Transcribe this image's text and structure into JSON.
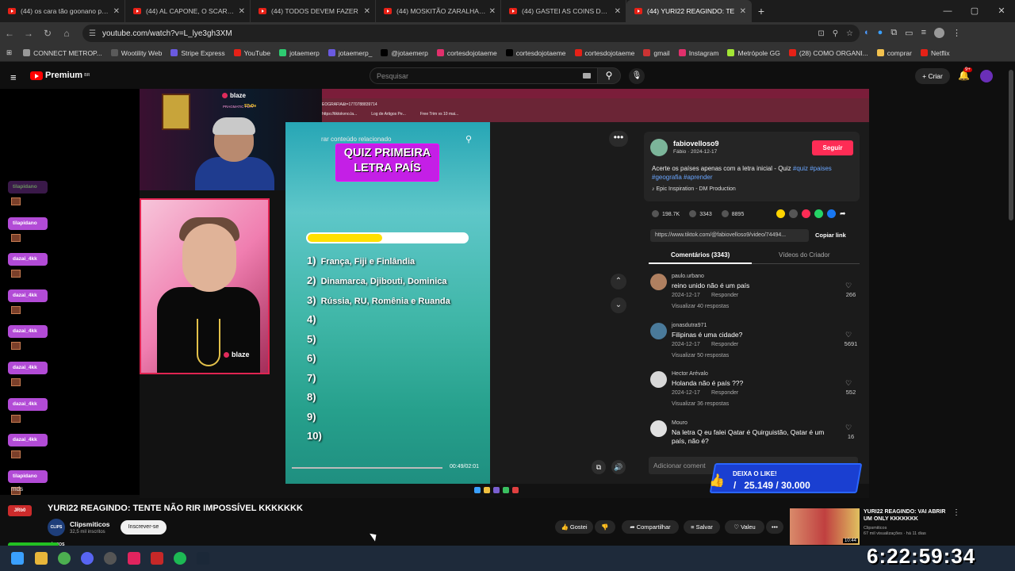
{
  "browser": {
    "tabs": [
      {
        "title": "(44) os cara tão goonano pra re"
      },
      {
        "title": "(44) AL CAPONE, O SCARFACE |"
      },
      {
        "title": "(44) TODOS DEVEM FAZER"
      },
      {
        "title": "(44) MOSKITÃO ZARALHANDO"
      },
      {
        "title": "(44) GASTEI AS COINS DO BAN"
      },
      {
        "title": "(44) YURI22 REAGINDO: TE",
        "active": true
      }
    ],
    "url": "youtube.com/watch?v=L_lye3gh3XM",
    "bookmarks": [
      "CONNECT METROP...",
      "Wootility Web",
      "Stripe Express",
      "YouTube",
      "jotaemerp",
      "jotaemerp_",
      "@jotaemerp",
      "cortesdojotaeme",
      "cortesdojotaeme",
      "cortesdojotaeme",
      "gmail",
      "Instagram",
      "Metrópole GG",
      "(28) COMO ORGANI...",
      "comprar",
      "Netflix"
    ]
  },
  "youtube": {
    "logo": "Premium",
    "logo_region": "BR",
    "search_placeholder": "Pesquisar",
    "create_label": "Criar",
    "notif_count": "9+",
    "video_title": "YURI22 REAGINDO: TENTE NÃO RIR IMPOSSÍVEL KKKKKKK",
    "channel_name": "Clipsmiticos",
    "channel_avatar_text": "CLIPS MÍTICOS",
    "channel_subs": "32,5 mil inscritos",
    "subscribe_label": "Inscrever-se",
    "actions": {
      "like": "Gostei",
      "share": "Compartilhar",
      "save": "Salvar",
      "thanks": "Valeu"
    },
    "recommended": {
      "title": "YURI22 REAGINDO: VAI ABRIR UM ONLY KKKKKKK",
      "channel": "Clipsmiticos",
      "meta": "67 mil visualizações · há 11 dias",
      "duration": "10:44"
    }
  },
  "chat": {
    "users": [
      "tilapidano",
      "tilapidano",
      "dazai_4kk",
      "dazai_4kk",
      "dazai_4kk",
      "dazai_4kk",
      "dazai_4kk",
      "dazai_4kk",
      "tilapidano"
    ],
    "bottom_text": "mds",
    "badge_top": "JRb0"
  },
  "overlay": {
    "brand": "blaze",
    "pragmatic": "PRAGMATIC PLAY",
    "stake_label": "STaDe",
    "like_banner_title": "DEIXA O LIKE!",
    "like_banner_count": "25.149 / 30.000"
  },
  "inner_browser": {
    "url": "EOGRAFIA&t=1770788839714",
    "links": [
      "https://tiktokvno.la...",
      "Log de Artigos Pe...",
      "Free Trim vs 10 mai..."
    ]
  },
  "tiktok": {
    "search_text": "rar conteúdo relacionado",
    "quiz_title_line1": "QUIZ PRIMEIRA",
    "quiz_title_line2": "LETRA PAÍS",
    "progress": 0.47,
    "answers": [
      {
        "n": "1)",
        "text": "França, Fiji e Finlândia"
      },
      {
        "n": "2)",
        "text": "Dinamarca, Djibouti, Dominica"
      },
      {
        "n": "3)",
        "text": "Rússia, RU, Romênia e Ruanda"
      },
      {
        "n": "4)",
        "text": ""
      },
      {
        "n": "5)",
        "text": ""
      },
      {
        "n": "6)",
        "text": ""
      },
      {
        "n": "7)",
        "text": ""
      },
      {
        "n": "8)",
        "text": ""
      },
      {
        "n": "9)",
        "text": ""
      },
      {
        "n": "10)",
        "text": ""
      }
    ],
    "time": "00:49/02:01",
    "author": "fabiovelloso9",
    "author_sub": "Fábio · 2024-12-17",
    "follow_label": "Seguir",
    "desc_text": "Acerte os países apenas com a letra inicial - Quiz",
    "desc_tags": [
      "#quiz",
      "#paises",
      "#geografia",
      "#aprender"
    ],
    "music": "Epic Inspiration - DM Production",
    "likes": "198.7K",
    "comments_count": "3343",
    "saves": "8895",
    "link": "https://www.tiktok.com/@fabiovelloso9/video/74494...",
    "copy_label": "Copiar link",
    "tab_comments": "Comentários (3343)",
    "tab_videos": "Vídeos do Criador",
    "comment_placeholder": "Adicionar coment",
    "comments": [
      {
        "user": "paulo.urbano",
        "text": "reino unido não é um país",
        "date": "2024-12-17",
        "reply": "Responder",
        "views": "Visualizar 40 respostas",
        "likes": "266",
        "color": "#b08060"
      },
      {
        "user": "jonasdutra971",
        "text": "Filipinas é uma cidade?",
        "date": "2024-12-17",
        "reply": "Responder",
        "views": "Visualizar 50 respostas",
        "likes": "5691",
        "color": "#4a7a9a"
      },
      {
        "user": "Hector Arévalo",
        "text": "Holanda não é país ???",
        "date": "2024-12-17",
        "reply": "Responder",
        "views": "Visualizar 36 respostas",
        "likes": "552",
        "color": "#d8d8d8"
      },
      {
        "user": "Mouro",
        "text": "Na letra Q eu falei Qatar é Quirguistão, Qatar é um país, não é?",
        "date": "",
        "reply": "",
        "views": "",
        "likes": "16",
        "color": "#e0e0e0"
      }
    ]
  },
  "taskbar": {
    "clock": "6:22:59:34"
  }
}
